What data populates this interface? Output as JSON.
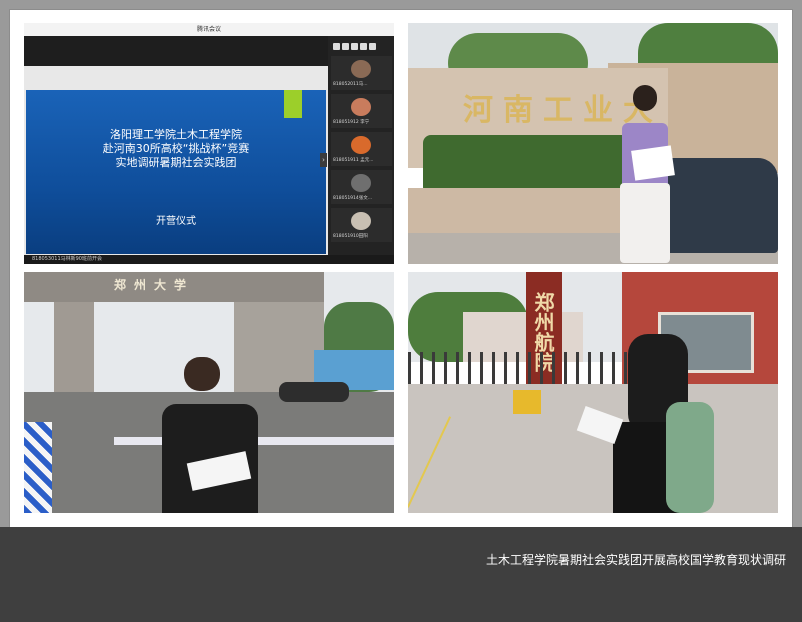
{
  "caption": "土木工程学院暑期社会实践团开展高校国学教育现状调研",
  "meeting": {
    "window_title": "腾讯会议",
    "slide_title_lines": [
      "洛阳理工学院土木工程学院",
      "赴河南30所高校“挑战杯”竞赛",
      "实地调研暑期社会实践团"
    ],
    "slide_subtitle": "开营仪式",
    "status_text": "818053011马林新90班前开会",
    "participants": [
      {
        "label": "818052011马..."
      },
      {
        "label": "818051912 李宁"
      },
      {
        "label": "818051911 孟元..."
      },
      {
        "label": "818051914张文..."
      },
      {
        "label": "818051910田阳"
      }
    ]
  },
  "photos": {
    "photo2_sign": "河南工业大",
    "photo4_sign": "郑州航院",
    "photo3_gate_sign": "郑州大学"
  },
  "colors": {
    "slide_blue": "#1a63b8",
    "accent_green": "#9ccf2a",
    "caption_bar": "#3f3f3f"
  }
}
